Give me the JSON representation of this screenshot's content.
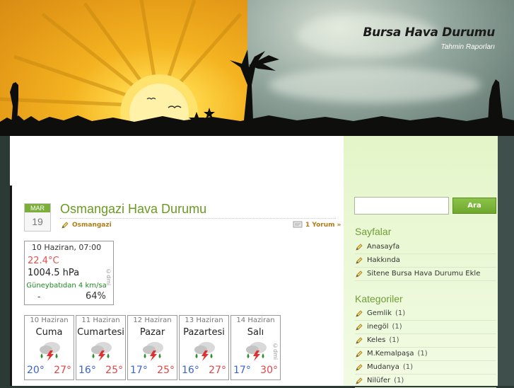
{
  "site": {
    "title": "Bursa Hava Durumu",
    "tagline": "Tahmin Raporları"
  },
  "post": {
    "date_month": "MAR",
    "date_day": "19",
    "title": "Osmangazi Hava Durumu",
    "category": "Osmangazi",
    "comments": "1 Yorum »"
  },
  "current_weather": {
    "datetime": "10 Haziran, 07:00",
    "temperature": "22.4°C",
    "pressure": "1004.5 hPa",
    "wind": "Güneybatıdan 4 km/sa",
    "precip": "-",
    "humidity": "64%",
    "credit": "©dmi"
  },
  "forecast": {
    "credit": "©dmi",
    "icon": "thunderstorm-rain-icon",
    "days": [
      {
        "date": "10 Haziran",
        "name": "Cuma",
        "low": "20°",
        "high": "27°"
      },
      {
        "date": "11 Haziran",
        "name": "Cumartesi",
        "low": "16°",
        "high": "25°"
      },
      {
        "date": "12 Haziran",
        "name": "Pazar",
        "low": "17°",
        "high": "25°"
      },
      {
        "date": "13 Haziran",
        "name": "Pazartesi",
        "low": "16°",
        "high": "27°"
      },
      {
        "date": "14 Haziran",
        "name": "Salı",
        "low": "17°",
        "high": "30°"
      }
    ]
  },
  "sidebar": {
    "search_button": "Ara",
    "search_value": "",
    "pages_title": "Sayfalar",
    "pages": [
      {
        "label": "Anasayfa"
      },
      {
        "label": "Hakkında"
      },
      {
        "label": "Sitene Bursa Hava Durumu Ekle"
      }
    ],
    "categories_title": "Kategoriler",
    "categories": [
      {
        "label": "Gemlik",
        "count": "(1)"
      },
      {
        "label": "inegöl",
        "count": "(1)"
      },
      {
        "label": "Keles",
        "count": "(1)"
      },
      {
        "label": "M.Kemalpaşa",
        "count": "(1)"
      },
      {
        "label": "Mudanya",
        "count": "(1)"
      },
      {
        "label": "Nilüfer",
        "count": "(1)"
      }
    ]
  },
  "colors": {
    "accent_green": "#6b9a23",
    "meta_orange": "#b07c16",
    "temp_high": "#e04545",
    "temp_low": "#3c63cf"
  }
}
